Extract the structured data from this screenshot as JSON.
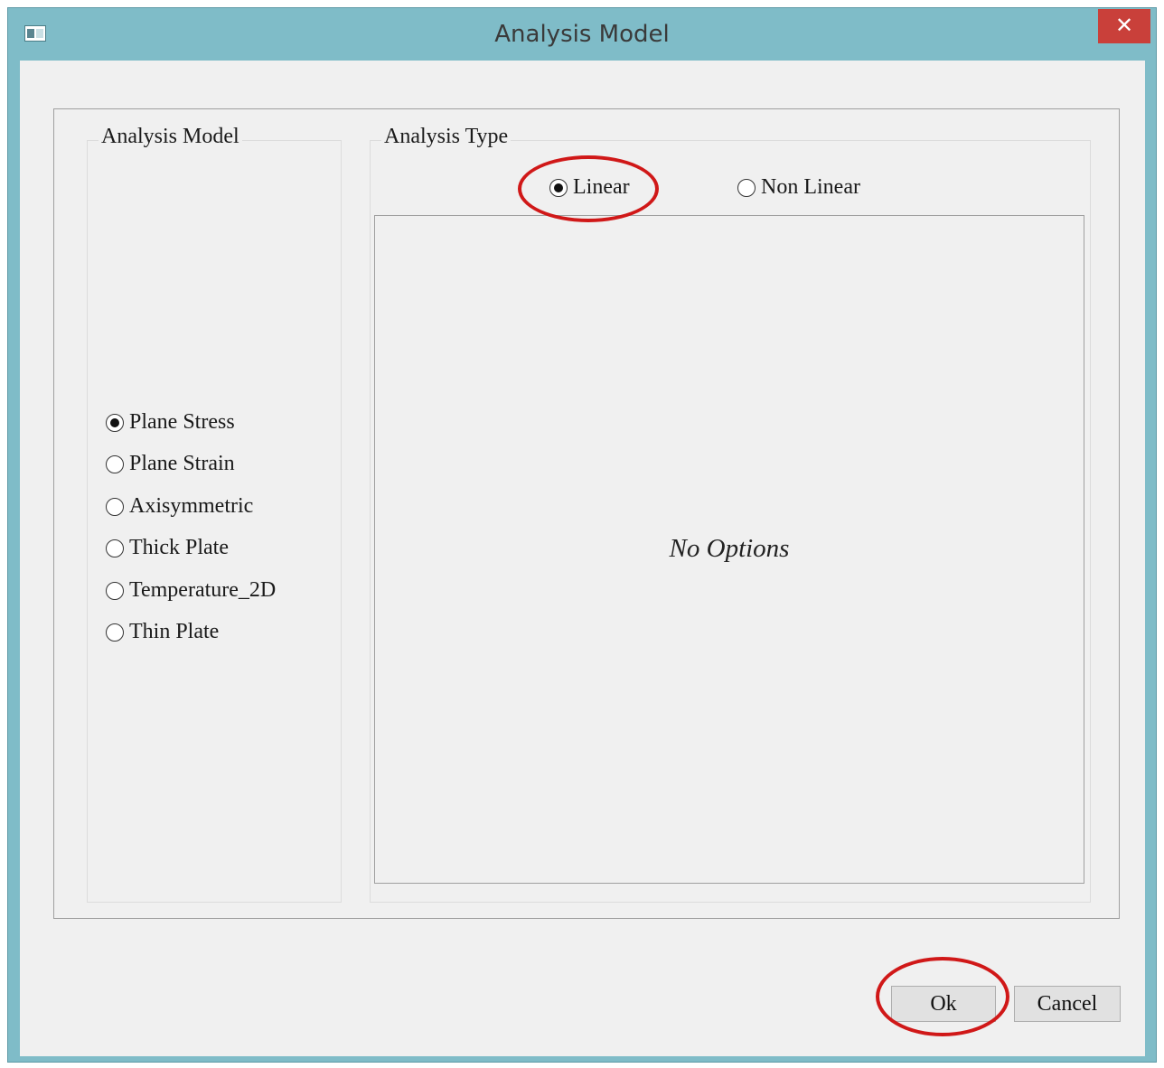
{
  "window": {
    "title": "Analysis Model",
    "close_label": "✕"
  },
  "analysis_model": {
    "group_title": "Analysis Model",
    "options": [
      {
        "label": "Plane Stress",
        "checked": true
      },
      {
        "label": "Plane Strain",
        "checked": false
      },
      {
        "label": "Axisymmetric",
        "checked": false
      },
      {
        "label": "Thick Plate",
        "checked": false
      },
      {
        "label": "Temperature_2D",
        "checked": false
      },
      {
        "label": "Thin Plate",
        "checked": false
      }
    ]
  },
  "analysis_type": {
    "group_title": "Analysis Type",
    "options": [
      {
        "label": "Linear",
        "checked": true
      },
      {
        "label": "Non Linear",
        "checked": false
      }
    ],
    "panel_text": "No Options"
  },
  "buttons": {
    "ok_label": "Ok",
    "cancel_label": "Cancel"
  },
  "colors": {
    "title_bar": "#7fbcc8",
    "close_button": "#c9403a",
    "highlight_ring": "#d01818",
    "dialog_background": "#f0f0f0"
  }
}
